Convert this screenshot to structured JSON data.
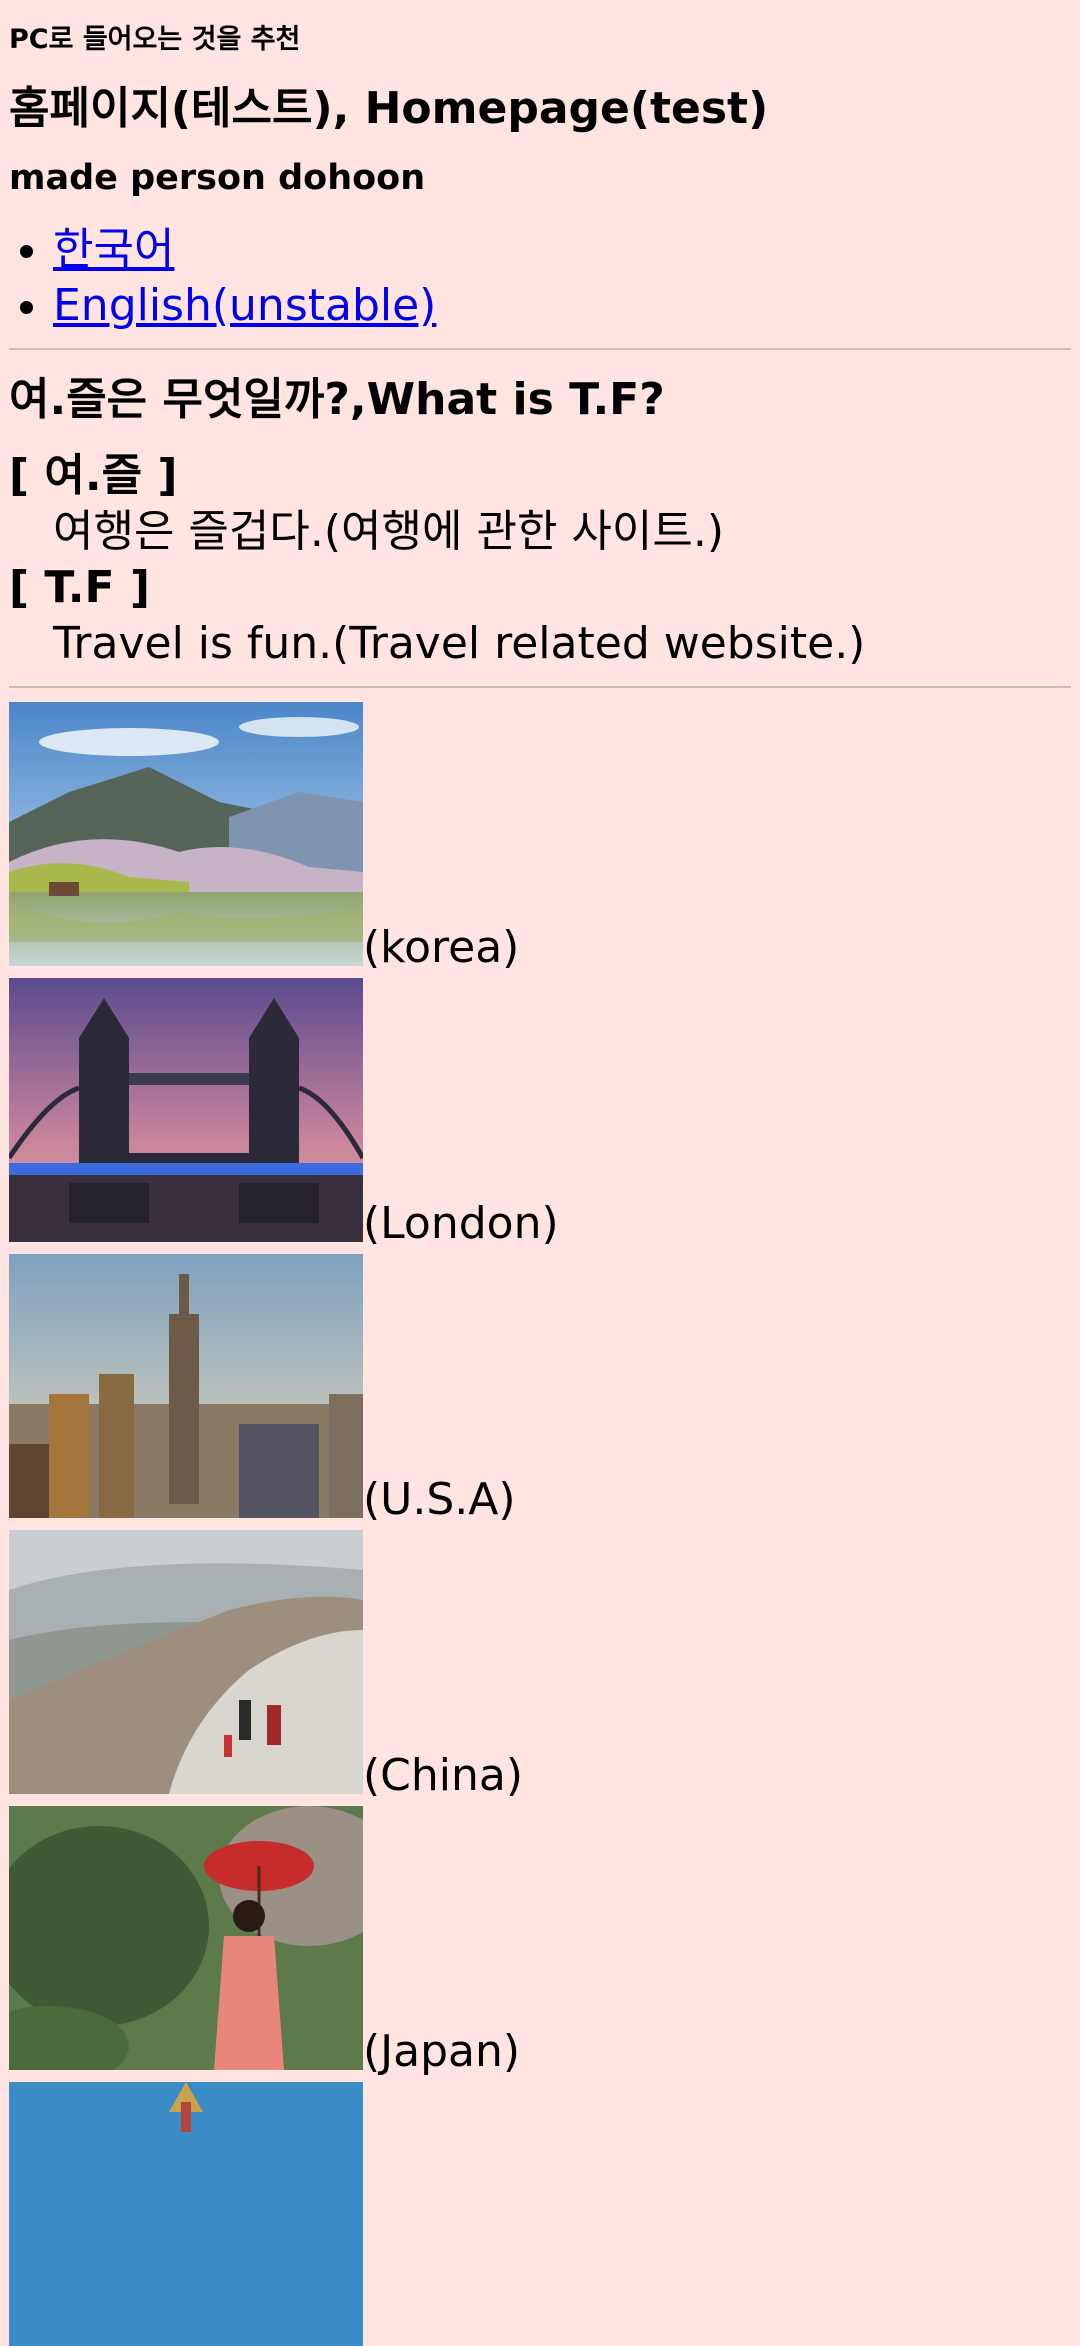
{
  "recommend": "PC로 들어오는 것을 추천",
  "title": "홈페이지(테스트), Homepage(test)",
  "author": "made person dohoon",
  "languages": [
    {
      "label": "한국어"
    },
    {
      "label": "English(unstable)"
    }
  ],
  "question": "여.즐은 무엇일까?,What is T.F?",
  "definitions": [
    {
      "term": "[ 여.즐 ]",
      "desc": "여행은 즐겁다.(여행에 관한 사이트.)"
    },
    {
      "term": "[ T.F ]",
      "desc": "Travel is fun.(Travel related website.)"
    }
  ],
  "places": [
    {
      "caption": "(korea)",
      "photo": "korea-landscape-photo"
    },
    {
      "caption": "(London)",
      "photo": "london-tower-bridge-photo"
    },
    {
      "caption": "(U.S.A)",
      "photo": "new-york-skyline-photo"
    },
    {
      "caption": "(China)",
      "photo": "great-wall-photo"
    },
    {
      "caption": "(Japan)",
      "photo": "japan-kimono-umbrella-photo"
    },
    {
      "caption": "",
      "photo": "russia-cathedral-photo"
    }
  ],
  "colors": {
    "background": "#ffe4e1",
    "link": "#0000ee",
    "divider": "#c9bcba"
  }
}
